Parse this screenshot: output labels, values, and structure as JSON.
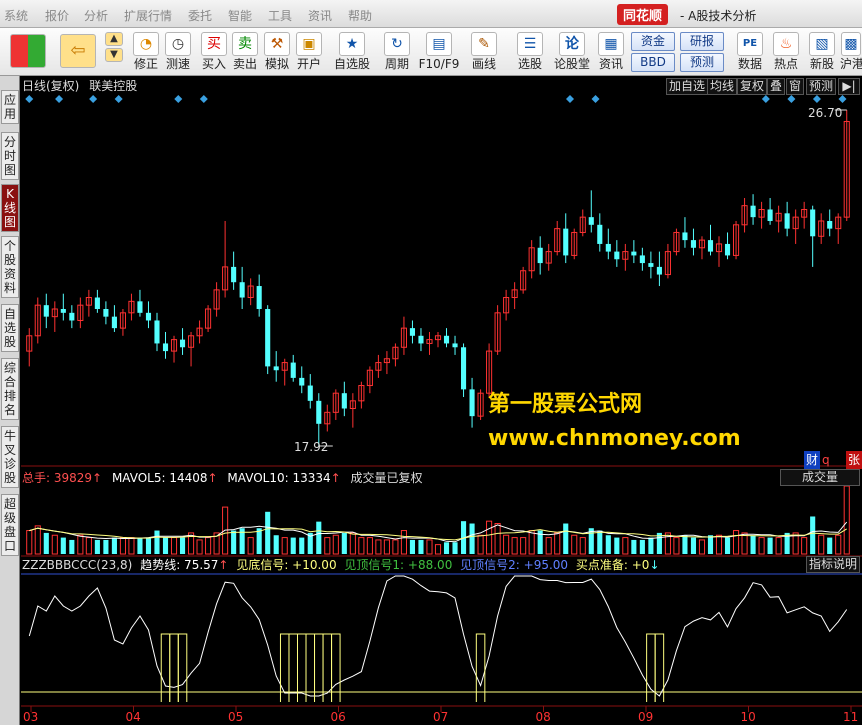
{
  "menu": {
    "items": [
      "系统",
      "报价",
      "分析",
      "扩展行情",
      "委托",
      "智能",
      "工具",
      "资讯",
      "帮助"
    ],
    "brand": "同花顺",
    "app_title": "- A股技术分析"
  },
  "toolbar": {
    "fix_label": "修正",
    "test_label": "测速",
    "buy_label": "买入",
    "sell_label": "卖出",
    "sim_label": "模拟",
    "open_label": "开户",
    "watchlist_label": "自选股",
    "period_label": "周期",
    "f10_label": "F10/F9",
    "draw_label": "画线",
    "select_label": "选股",
    "forum_label": "论股堂",
    "news_label": "资讯",
    "pill_funds": "资金",
    "pill_research": "研报",
    "pill_bbd": "BBD",
    "pill_forecast": "预测",
    "data_label": "数据",
    "hot_label": "热点",
    "newstock_label": "新股",
    "sh_label": "沪港"
  },
  "sidebar": {
    "tabs": [
      "应用",
      "分时图",
      "K线图",
      "个股资料",
      "自选股",
      "综合排名",
      "牛叉诊股",
      "超级盘口"
    ]
  },
  "price_panel": {
    "title": "日线(复权)",
    "stock_name": "联美控股",
    "buttons": [
      "加自选",
      "均线",
      "复权",
      "叠",
      "窗",
      "预测"
    ],
    "high_label": "26.70",
    "low_label": "17.92",
    "markers_right": [
      "财",
      "q",
      "张"
    ]
  },
  "volume_panel": {
    "total_label": "总手: 39829",
    "mavol5": "MAVOL5: 14408",
    "mavol10": "MAVOL10: 13334",
    "note": "成交量已复权",
    "button": "成交量"
  },
  "indicator_panel": {
    "name": "ZZZBBBCCC(23,8)",
    "trend": "趋势线: 75.57",
    "bottom": "见底信号: +10.00",
    "sig1": "见顶信号1: +88.00",
    "sig2": "见顶信号2: +95.00",
    "buyprep": "买点准备: +0",
    "help_button": "指标说明"
  },
  "watermark": {
    "line1": "第一股票公式网",
    "line2": "www.chnmoney.com"
  },
  "colors": {
    "up": "#ff3232",
    "down": "#54ffff",
    "bg": "#000000",
    "grid": "#8a1010",
    "trend": "#ffffff",
    "signal": "#ffff80",
    "watermark": "#ffd700"
  },
  "chart_data": {
    "type": "candlestick",
    "x_ticks": [
      "03",
      "04",
      "05",
      "06",
      "07",
      "08",
      "09",
      "10",
      "11"
    ],
    "price_range": [
      17.92,
      26.7
    ],
    "candles": [
      {
        "o": 20.4,
        "h": 21.0,
        "l": 20.0,
        "c": 20.8
      },
      {
        "o": 20.8,
        "h": 21.8,
        "l": 20.6,
        "c": 21.6
      },
      {
        "o": 21.6,
        "h": 21.9,
        "l": 21.0,
        "c": 21.3
      },
      {
        "o": 21.3,
        "h": 21.7,
        "l": 20.9,
        "c": 21.5
      },
      {
        "o": 21.5,
        "h": 21.9,
        "l": 21.2,
        "c": 21.4
      },
      {
        "o": 21.4,
        "h": 21.6,
        "l": 21.0,
        "c": 21.2
      },
      {
        "o": 21.2,
        "h": 21.8,
        "l": 21.0,
        "c": 21.6
      },
      {
        "o": 21.6,
        "h": 22.0,
        "l": 21.3,
        "c": 21.8
      },
      {
        "o": 21.8,
        "h": 22.0,
        "l": 21.4,
        "c": 21.5
      },
      {
        "o": 21.5,
        "h": 21.7,
        "l": 21.1,
        "c": 21.3
      },
      {
        "o": 21.3,
        "h": 21.6,
        "l": 20.9,
        "c": 21.0
      },
      {
        "o": 21.0,
        "h": 21.5,
        "l": 20.8,
        "c": 21.4
      },
      {
        "o": 21.4,
        "h": 21.9,
        "l": 21.2,
        "c": 21.7
      },
      {
        "o": 21.7,
        "h": 22.0,
        "l": 21.3,
        "c": 21.4
      },
      {
        "o": 21.4,
        "h": 21.7,
        "l": 21.0,
        "c": 21.2
      },
      {
        "o": 21.2,
        "h": 21.4,
        "l": 20.4,
        "c": 20.6
      },
      {
        "o": 20.6,
        "h": 20.9,
        "l": 20.2,
        "c": 20.4
      },
      {
        "o": 20.4,
        "h": 20.8,
        "l": 20.1,
        "c": 20.7
      },
      {
        "o": 20.7,
        "h": 21.0,
        "l": 20.3,
        "c": 20.5
      },
      {
        "o": 20.5,
        "h": 20.9,
        "l": 20.0,
        "c": 20.8
      },
      {
        "o": 20.8,
        "h": 21.2,
        "l": 20.6,
        "c": 21.0
      },
      {
        "o": 21.0,
        "h": 21.6,
        "l": 20.9,
        "c": 21.5
      },
      {
        "o": 21.5,
        "h": 22.2,
        "l": 21.3,
        "c": 22.0
      },
      {
        "o": 22.0,
        "h": 23.8,
        "l": 21.8,
        "c": 22.6
      },
      {
        "o": 22.6,
        "h": 23.0,
        "l": 22.0,
        "c": 22.2
      },
      {
        "o": 22.2,
        "h": 22.6,
        "l": 21.5,
        "c": 21.8
      },
      {
        "o": 21.8,
        "h": 22.3,
        "l": 21.6,
        "c": 22.1
      },
      {
        "o": 22.1,
        "h": 22.4,
        "l": 21.3,
        "c": 21.5
      },
      {
        "o": 21.5,
        "h": 21.6,
        "l": 19.8,
        "c": 20.0
      },
      {
        "o": 20.0,
        "h": 20.4,
        "l": 19.6,
        "c": 19.9
      },
      {
        "o": 19.9,
        "h": 20.2,
        "l": 19.5,
        "c": 20.1
      },
      {
        "o": 20.1,
        "h": 20.3,
        "l": 19.6,
        "c": 19.7
      },
      {
        "o": 19.7,
        "h": 20.0,
        "l": 19.3,
        "c": 19.5
      },
      {
        "o": 19.5,
        "h": 19.8,
        "l": 18.9,
        "c": 19.1
      },
      {
        "o": 19.1,
        "h": 19.3,
        "l": 17.92,
        "c": 18.5
      },
      {
        "o": 18.5,
        "h": 19.0,
        "l": 18.3,
        "c": 18.8
      },
      {
        "o": 18.8,
        "h": 19.4,
        "l": 18.6,
        "c": 19.3
      },
      {
        "o": 19.3,
        "h": 19.6,
        "l": 18.7,
        "c": 18.9
      },
      {
        "o": 18.9,
        "h": 19.3,
        "l": 18.4,
        "c": 19.1
      },
      {
        "o": 19.1,
        "h": 19.6,
        "l": 18.9,
        "c": 19.5
      },
      {
        "o": 19.5,
        "h": 20.0,
        "l": 19.3,
        "c": 19.9
      },
      {
        "o": 19.9,
        "h": 20.3,
        "l": 19.7,
        "c": 20.1
      },
      {
        "o": 20.1,
        "h": 20.4,
        "l": 19.8,
        "c": 20.2
      },
      {
        "o": 20.2,
        "h": 20.6,
        "l": 20.0,
        "c": 20.5
      },
      {
        "o": 20.5,
        "h": 21.3,
        "l": 20.3,
        "c": 21.0
      },
      {
        "o": 21.0,
        "h": 21.2,
        "l": 20.6,
        "c": 20.8
      },
      {
        "o": 20.8,
        "h": 21.0,
        "l": 20.4,
        "c": 20.6
      },
      {
        "o": 20.6,
        "h": 20.9,
        "l": 20.3,
        "c": 20.7
      },
      {
        "o": 20.7,
        "h": 20.9,
        "l": 20.5,
        "c": 20.8
      },
      {
        "o": 20.8,
        "h": 21.0,
        "l": 20.5,
        "c": 20.6
      },
      {
        "o": 20.6,
        "h": 20.8,
        "l": 20.3,
        "c": 20.5
      },
      {
        "o": 20.5,
        "h": 20.6,
        "l": 19.2,
        "c": 19.4
      },
      {
        "o": 19.4,
        "h": 19.7,
        "l": 18.4,
        "c": 18.7
      },
      {
        "o": 18.7,
        "h": 19.4,
        "l": 18.6,
        "c": 19.3
      },
      {
        "o": 19.3,
        "h": 20.6,
        "l": 19.2,
        "c": 20.4
      },
      {
        "o": 20.4,
        "h": 21.6,
        "l": 20.3,
        "c": 21.4
      },
      {
        "o": 21.4,
        "h": 22.0,
        "l": 21.2,
        "c": 21.8
      },
      {
        "o": 21.8,
        "h": 22.2,
        "l": 21.5,
        "c": 22.0
      },
      {
        "o": 22.0,
        "h": 22.6,
        "l": 21.9,
        "c": 22.5
      },
      {
        "o": 22.5,
        "h": 23.3,
        "l": 22.3,
        "c": 23.1
      },
      {
        "o": 23.1,
        "h": 23.4,
        "l": 22.4,
        "c": 22.7
      },
      {
        "o": 22.7,
        "h": 23.2,
        "l": 22.5,
        "c": 23.0
      },
      {
        "o": 23.0,
        "h": 23.8,
        "l": 22.9,
        "c": 23.6
      },
      {
        "o": 23.6,
        "h": 24.0,
        "l": 22.7,
        "c": 22.9
      },
      {
        "o": 22.9,
        "h": 23.6,
        "l": 22.8,
        "c": 23.5
      },
      {
        "o": 23.5,
        "h": 24.1,
        "l": 23.4,
        "c": 23.9
      },
      {
        "o": 23.9,
        "h": 24.6,
        "l": 23.5,
        "c": 23.7
      },
      {
        "o": 23.7,
        "h": 24.0,
        "l": 23.0,
        "c": 23.2
      },
      {
        "o": 23.2,
        "h": 23.6,
        "l": 22.8,
        "c": 23.0
      },
      {
        "o": 23.0,
        "h": 23.3,
        "l": 22.6,
        "c": 22.8
      },
      {
        "o": 22.8,
        "h": 23.2,
        "l": 22.5,
        "c": 23.0
      },
      {
        "o": 23.0,
        "h": 23.3,
        "l": 22.7,
        "c": 22.9
      },
      {
        "o": 22.9,
        "h": 23.1,
        "l": 22.5,
        "c": 22.7
      },
      {
        "o": 22.7,
        "h": 23.0,
        "l": 22.3,
        "c": 22.6
      },
      {
        "o": 22.6,
        "h": 23.0,
        "l": 22.1,
        "c": 22.4
      },
      {
        "o": 22.4,
        "h": 23.2,
        "l": 22.3,
        "c": 23.0
      },
      {
        "o": 23.0,
        "h": 23.6,
        "l": 22.9,
        "c": 23.5
      },
      {
        "o": 23.5,
        "h": 23.9,
        "l": 23.1,
        "c": 23.3
      },
      {
        "o": 23.3,
        "h": 23.6,
        "l": 22.9,
        "c": 23.1
      },
      {
        "o": 23.1,
        "h": 23.4,
        "l": 22.8,
        "c": 23.3
      },
      {
        "o": 23.3,
        "h": 23.7,
        "l": 22.9,
        "c": 23.0
      },
      {
        "o": 23.0,
        "h": 23.4,
        "l": 22.6,
        "c": 23.2
      },
      {
        "o": 23.2,
        "h": 23.5,
        "l": 22.8,
        "c": 22.9
      },
      {
        "o": 22.9,
        "h": 23.8,
        "l": 22.8,
        "c": 23.7
      },
      {
        "o": 23.7,
        "h": 24.4,
        "l": 23.5,
        "c": 24.2
      },
      {
        "o": 24.2,
        "h": 24.5,
        "l": 23.7,
        "c": 23.9
      },
      {
        "o": 23.9,
        "h": 24.3,
        "l": 23.6,
        "c": 24.1
      },
      {
        "o": 24.1,
        "h": 24.4,
        "l": 23.7,
        "c": 23.8
      },
      {
        "o": 23.8,
        "h": 24.2,
        "l": 23.5,
        "c": 24.0
      },
      {
        "o": 24.0,
        "h": 24.3,
        "l": 23.4,
        "c": 23.6
      },
      {
        "o": 23.6,
        "h": 24.1,
        "l": 23.2,
        "c": 23.9
      },
      {
        "o": 23.9,
        "h": 24.3,
        "l": 23.6,
        "c": 24.1
      },
      {
        "o": 24.1,
        "h": 24.2,
        "l": 22.6,
        "c": 23.4
      },
      {
        "o": 23.4,
        "h": 24.0,
        "l": 23.2,
        "c": 23.8
      },
      {
        "o": 23.8,
        "h": 24.1,
        "l": 23.4,
        "c": 23.6
      },
      {
        "o": 23.6,
        "h": 24.0,
        "l": 23.2,
        "c": 23.9
      },
      {
        "o": 23.9,
        "h": 26.7,
        "l": 23.8,
        "c": 26.4
      }
    ]
  }
}
